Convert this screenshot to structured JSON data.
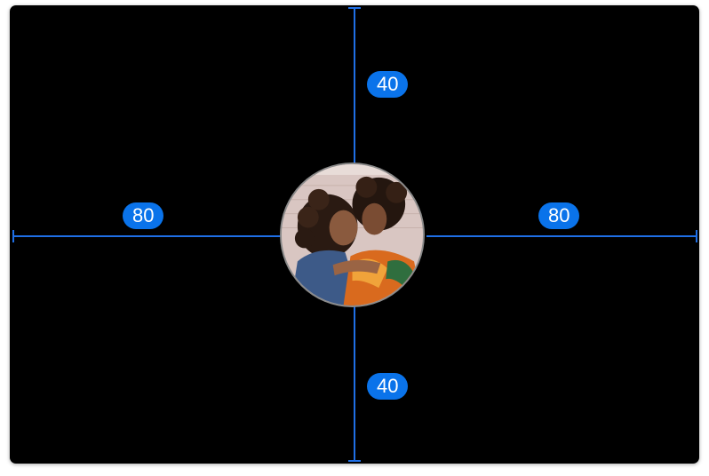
{
  "spacing": {
    "top": "40",
    "bottom": "40",
    "left": "80",
    "right": "80"
  },
  "colors": {
    "canvas": "#000000",
    "guide": "#1f6fe6",
    "badge": "#0a73ea",
    "badge_text": "#ffffff",
    "avatar_border": "#8a8a8a"
  },
  "avatar": {
    "description_icon": "avatar-photo"
  }
}
